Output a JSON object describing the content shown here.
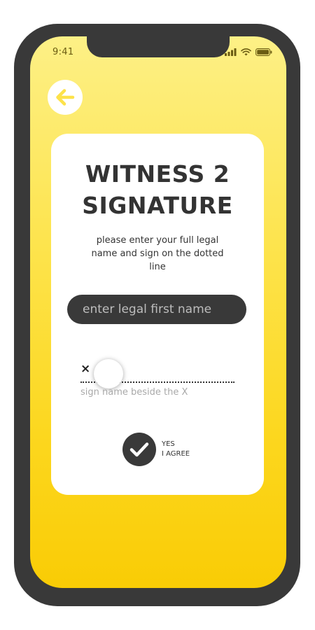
{
  "status_bar": {
    "time": "9:41",
    "icons": [
      "signal-icon",
      "wifi-icon",
      "battery-icon"
    ]
  },
  "nav": {
    "back_icon": "arrow-left-icon"
  },
  "card": {
    "title_line1": "WITNESS 2",
    "title_line2": "SIGNATURE",
    "subtitle": "please enter your full legal name and sign on the dotted line",
    "name_input": {
      "placeholder": "enter legal first name",
      "value": ""
    },
    "signature": {
      "x_mark": "×",
      "hint": "sign name beside the X"
    },
    "agree": {
      "icon": "checkmark-icon",
      "line1": "YES",
      "line2": "I AGREE"
    }
  },
  "colors": {
    "gradient_top": "#fdf086",
    "gradient_bottom": "#f9cc05",
    "dark": "#393939",
    "card": "#ffffff"
  }
}
